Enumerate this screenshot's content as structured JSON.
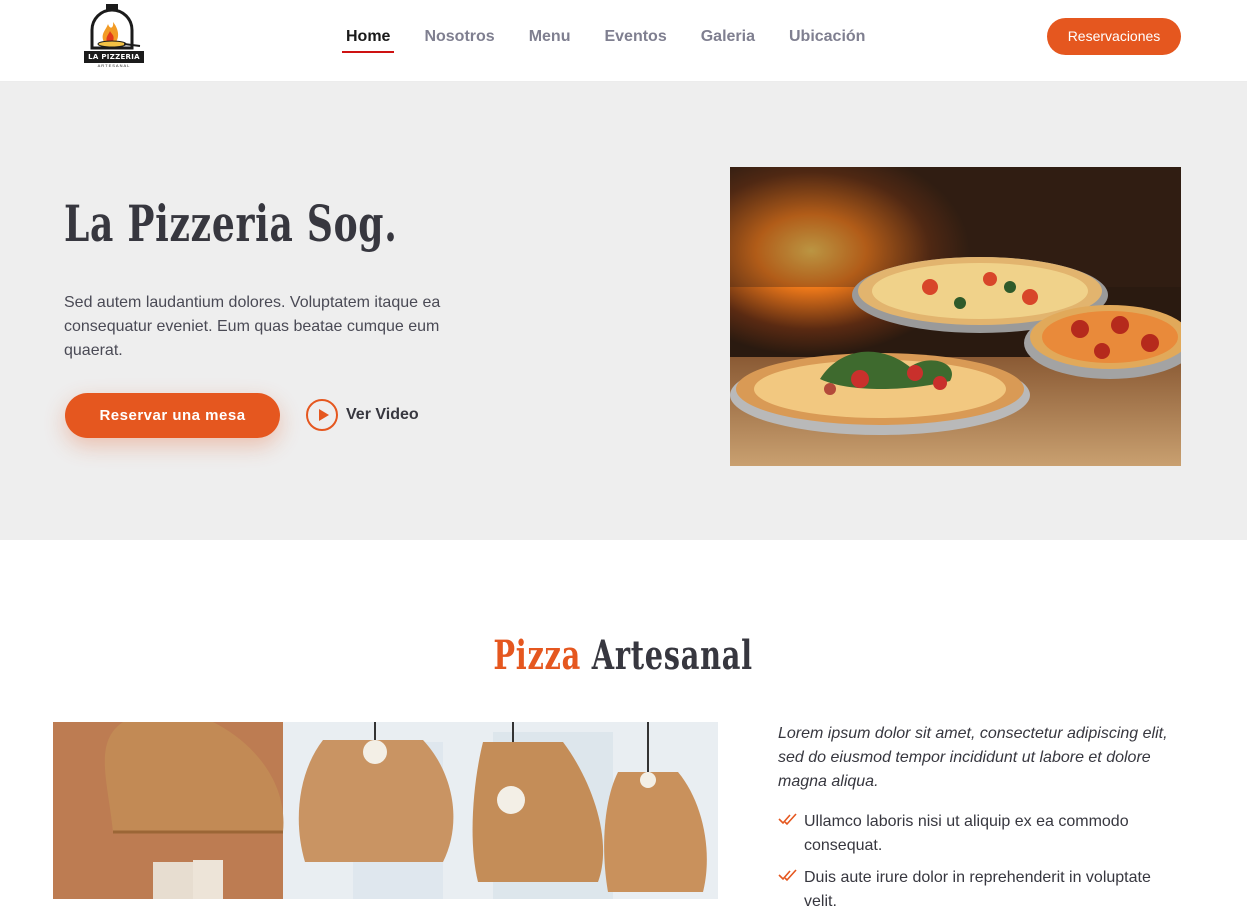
{
  "brand": {
    "logo_text": "LA PIZZERIA",
    "logo_sub": "ARTESANAL",
    "logo_icon": "pizza-oven-logo-icon"
  },
  "nav": {
    "items": [
      "Home",
      "Nosotros",
      "Menu",
      "Eventos",
      "Galeria",
      "Ubicación"
    ],
    "active": "Home"
  },
  "header": {
    "cta": "Reservaciones"
  },
  "hero": {
    "title": "La Pizzeria Sog.",
    "text": "Sed autem laudantium dolores. Voluptatem itaque ea consequatur eveniet. Eum quas beatae cumque eum quaerat.",
    "book_btn": "Reservar una mesa",
    "video_label": "Ver Video",
    "video_icon": "play-circle-icon"
  },
  "about": {
    "title_accent": "Pizza",
    "title_rest": "Artesanal",
    "lead": "Lorem ipsum dolor sit amet, consectetur adipiscing elit, sed do eiusmod tempor incididunt ut labore et dolore magna aliqua.",
    "bullets": [
      "Ullamco laboris nisi ut aliquip ex ea commodo consequat.",
      "Duis aute irure dolor in reprehenderit in voluptate velit."
    ],
    "bullet_icon": "double-check-icon"
  },
  "colors": {
    "accent": "#e5571f",
    "hero_bg": "#eeeeee",
    "text": "#37373f",
    "nav_muted": "#7f7f90"
  }
}
